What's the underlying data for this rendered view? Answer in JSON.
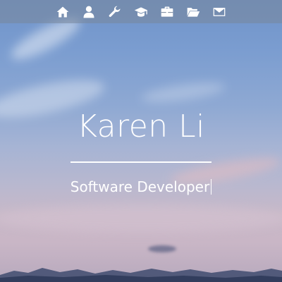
{
  "nav": {
    "items": [
      {
        "icon": "home-icon"
      },
      {
        "icon": "user-icon"
      },
      {
        "icon": "wrench-icon"
      },
      {
        "icon": "graduation-cap-icon"
      },
      {
        "icon": "briefcase-icon"
      },
      {
        "icon": "folder-open-icon"
      },
      {
        "icon": "envelope-icon"
      }
    ]
  },
  "hero": {
    "name": "Karen Li",
    "subtitle": "Software Developer"
  },
  "colors": {
    "text": "#ffffff",
    "navbar": "rgba(120,135,155,0.55)",
    "sky_top": "#6f93c9",
    "sky_bottom": "#c9b6c6"
  }
}
